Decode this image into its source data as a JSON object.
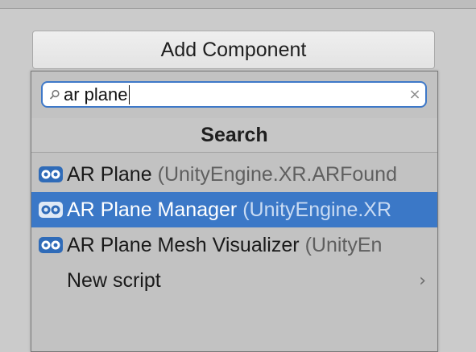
{
  "add_component": {
    "label": "Add Component"
  },
  "search": {
    "value": "ar plane",
    "search_icon": "search-icon",
    "clear_icon": "clear-icon",
    "clear_glyph": "×"
  },
  "section": {
    "header": "Search"
  },
  "results": [
    {
      "name": "AR Plane",
      "namespace": "(UnityEngine.XR.ARFound",
      "icon": "ar-component-icon",
      "selected": false
    },
    {
      "name": "AR Plane Manager",
      "namespace": "(UnityEngine.XR",
      "icon": "ar-component-icon",
      "selected": true
    },
    {
      "name": "AR Plane Mesh Visualizer",
      "namespace": "(UnityEn",
      "icon": "ar-component-icon",
      "selected": false
    }
  ],
  "new_script": {
    "label": "New script",
    "chevron": "›",
    "icon": "chevron-right-icon"
  },
  "colors": {
    "selection": "#3b78c7",
    "search_border": "#3e78c8",
    "icon_blue": "#2f6bb8"
  }
}
